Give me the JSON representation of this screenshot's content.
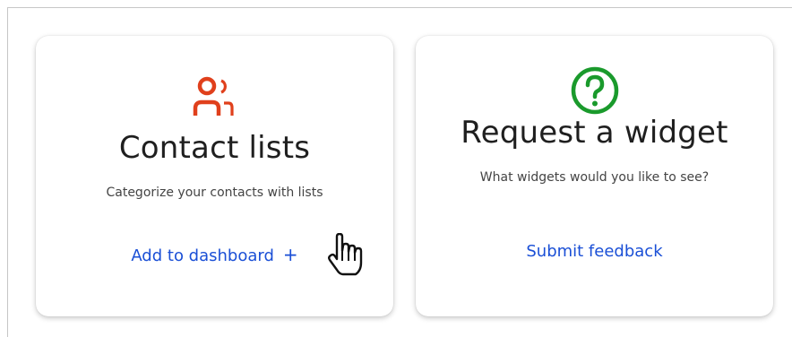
{
  "cards": [
    {
      "title": "Contact lists",
      "description": "Categorize your contacts with lists",
      "action_label": "Add to dashboard",
      "action_symbol": "+",
      "icon": "contacts-icon",
      "icon_color": "#e0401c"
    },
    {
      "title": "Request a widget",
      "description": "What widgets would you like to see?",
      "action_label": "Submit feedback",
      "icon": "question-circle-icon",
      "icon_color": "#1a9a2c"
    }
  ],
  "colors": {
    "link": "#1a4fd6",
    "title": "#1f1f1f",
    "description": "#444444",
    "frame_border": "#c6c6c6"
  },
  "cursor": "hand-pointer-icon"
}
